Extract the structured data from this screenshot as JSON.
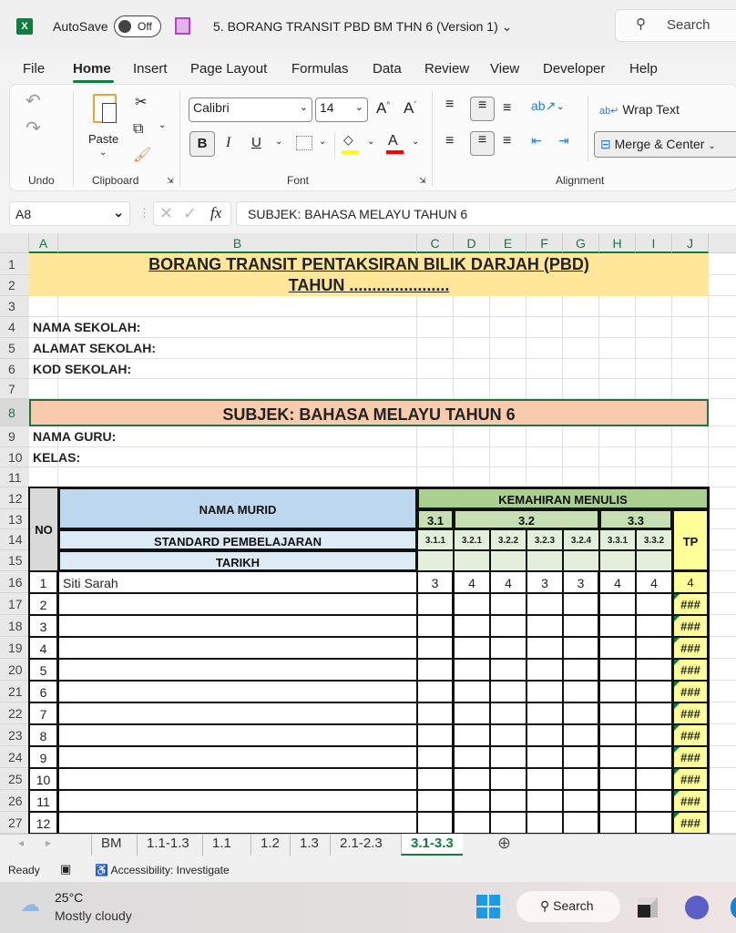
{
  "titlebar": {
    "app_icon": "excel-icon",
    "autosave_label": "AutoSave",
    "autosave_state": "Off",
    "document_title": "5. BORANG TRANSIT PBD BM THN 6 (Version 1)",
    "search_placeholder": "Search"
  },
  "menu": {
    "tabs": [
      "File",
      "Home",
      "Insert",
      "Page Layout",
      "Formulas",
      "Data",
      "Review",
      "View",
      "Developer",
      "Help"
    ],
    "active": "Home"
  },
  "ribbon": {
    "groups": {
      "undo": "Undo",
      "clipboard": "Clipboard",
      "font": "Font",
      "alignment": "Alignment"
    },
    "paste_label": "Paste",
    "font_name": "Calibri",
    "font_size": "14",
    "bold": "B",
    "italic": "I",
    "underline": "U",
    "wrap_text": "Wrap Text",
    "merge_center": "Merge & Center",
    "highlight_color": "#ffff00",
    "font_color": "#ff0000"
  },
  "formula_bar": {
    "name_box": "A8",
    "fx": "fx",
    "formula": "SUBJEK: BAHASA MELAYU TAHUN 6"
  },
  "sheet": {
    "columns": [
      "A",
      "B",
      "C",
      "D",
      "E",
      "F",
      "G",
      "H",
      "I",
      "J"
    ],
    "title1": "BORANG TRANSIT PENTAKSIRAN BILIK DARJAH (PBD)",
    "title2": "TAHUN ......................",
    "nama_sekolah": "NAMA SEKOLAH:",
    "alamat_sekolah": "ALAMAT SEKOLAH:",
    "kod_sekolah": "KOD SEKOLAH:",
    "subjek": "SUBJEK: BAHASA MELAYU TAHUN 6",
    "nama_guru": "NAMA GURU:",
    "kelas": "KELAS:",
    "header": {
      "no": "NO",
      "nama_murid": "NAMA MURID",
      "standard": "STANDARD PEMBELAJARAN",
      "tarikh": "TARIKH",
      "kemahiran": "KEMAHIRAN MENULIS",
      "groups": [
        "3.1",
        "3.2",
        "3.3"
      ],
      "standards": [
        "3.1.1",
        "3.2.1",
        "3.2.2",
        "3.2.3",
        "3.2.4",
        "3.3.1",
        "3.3.2"
      ],
      "tp": "TP"
    },
    "students": [
      {
        "no": "1",
        "name": "Siti Sarah",
        "scores": [
          "3",
          "4",
          "4",
          "3",
          "3",
          "4",
          "4"
        ],
        "tp": "4"
      },
      {
        "no": "2",
        "name": "",
        "scores": [
          "",
          "",
          "",
          "",
          "",
          "",
          ""
        ],
        "tp": "###"
      },
      {
        "no": "3",
        "name": "",
        "scores": [
          "",
          "",
          "",
          "",
          "",
          "",
          ""
        ],
        "tp": "###"
      },
      {
        "no": "4",
        "name": "",
        "scores": [
          "",
          "",
          "",
          "",
          "",
          "",
          ""
        ],
        "tp": "###"
      },
      {
        "no": "5",
        "name": "",
        "scores": [
          "",
          "",
          "",
          "",
          "",
          "",
          ""
        ],
        "tp": "###"
      },
      {
        "no": "6",
        "name": "",
        "scores": [
          "",
          "",
          "",
          "",
          "",
          "",
          ""
        ],
        "tp": "###"
      },
      {
        "no": "7",
        "name": "",
        "scores": [
          "",
          "",
          "",
          "",
          "",
          "",
          ""
        ],
        "tp": "###"
      },
      {
        "no": "8",
        "name": "",
        "scores": [
          "",
          "",
          "",
          "",
          "",
          "",
          ""
        ],
        "tp": "###"
      },
      {
        "no": "9",
        "name": "",
        "scores": [
          "",
          "",
          "",
          "",
          "",
          "",
          ""
        ],
        "tp": "###"
      },
      {
        "no": "10",
        "name": "",
        "scores": [
          "",
          "",
          "",
          "",
          "",
          "",
          ""
        ],
        "tp": "###"
      },
      {
        "no": "11",
        "name": "",
        "scores": [
          "",
          "",
          "",
          "",
          "",
          "",
          ""
        ],
        "tp": "###"
      },
      {
        "no": "12",
        "name": "",
        "scores": [
          "",
          "",
          "",
          "",
          "",
          "",
          ""
        ],
        "tp": "###"
      }
    ],
    "colors": {
      "title_fill": "#ffe699",
      "subject_fill": "#f8cbad",
      "nama_murid_fill": "#bdd7ee",
      "standard_fill": "#ddebf7",
      "no_fill": "#d9d9d9",
      "kemahiran_fill": "#a9d08e",
      "group_fill": "#c6e0b4",
      "std_fill": "#e2efda",
      "tp_fill": "#ffff99"
    }
  },
  "sheet_tabs": {
    "tabs": [
      "BM",
      "1.1-1.3",
      "1.1",
      "1.2",
      "1.3",
      "2.1-2.3",
      "3.1-3.3"
    ],
    "active": "3.1-3.3"
  },
  "status": {
    "ready": "Ready",
    "accessibility": "Accessibility: Investigate"
  },
  "taskbar": {
    "temperature": "25°C",
    "weather": "Mostly cloudy",
    "search": "Search"
  }
}
